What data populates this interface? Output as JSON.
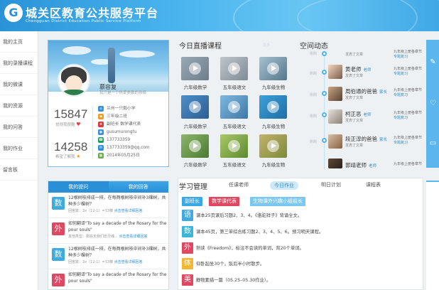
{
  "header": {
    "title": "城关区教育公共服务平台",
    "subtitle": "Chengguan District Education Public Service Platform"
  },
  "sidebar": {
    "items": [
      {
        "label": "我的主页"
      },
      {
        "label": "我的录播课程"
      },
      {
        "label": "我的微课"
      },
      {
        "label": "我的资源"
      },
      {
        "label": "我的问答"
      },
      {
        "label": "我的作业"
      },
      {
        "label": "留言板"
      }
    ]
  },
  "profile": {
    "name": "慕容复",
    "motto": "我只是一个热爱美数的孩纸",
    "stat1_value": "15847",
    "stat1_label": "觉得我很酷",
    "stat2_value": "14258",
    "stat2_label": "希望了解我",
    "info": [
      {
        "text": "兰州一只毅小学",
        "color": "#3b8fd4"
      },
      {
        "text": "三年级二班",
        "color": "#f59a23"
      },
      {
        "text": "副班长  数学课代表",
        "color": "#e3393c"
      },
      {
        "text": "gusumurongfu",
        "color": "#3b8fd4"
      },
      {
        "text": "137733359",
        "color": "#19a05a"
      },
      {
        "text": "137733359@qq.com",
        "color": "#2a8fd6"
      },
      {
        "text": "2014年05月25日",
        "color": "#6aa84f"
      }
    ]
  },
  "qa": {
    "tab_questions": "我的提问",
    "tab_answers": "我的回答",
    "items": [
      {
        "badge": "数",
        "color": "#3fa9e0",
        "text": "12根树枝排成一排，在每两根树枝中间补3棵树，共种多少棵树？",
        "meta": "回答数：3x（12-1）=33棵",
        "link": "点击查看详细回答"
      },
      {
        "badge": "外",
        "color": "#e04760",
        "text": "如何翻译\"To say a decade of the Rosary for the pour souls\"",
        "meta": "其他类型：那些天我们愿灵魂...",
        "link": "点击查看详细回答"
      },
      {
        "badge": "数",
        "color": "#3fa9e0",
        "text": "12根树枝排成一排，在每两根树枝中间补3棵树，共种多少棵树？",
        "meta": "回答数：3x（12-1）=33棵",
        "link": "点击查看详细回答"
      },
      {
        "badge": "外",
        "color": "#e04760",
        "text": "如何翻译\"To say a decade of the Rosary for the pour souls\"",
        "meta": "",
        "link": ""
      }
    ]
  },
  "live": {
    "title": "今日直播课程",
    "more": "更多",
    "courses": [
      {
        "label": "六年级数学"
      },
      {
        "label": "五年级语文"
      },
      {
        "label": "九年级生物"
      },
      {
        "label": "六年级数学"
      },
      {
        "label": "五年级语文"
      },
      {
        "label": "九年级生物"
      },
      {
        "label": "六年级数学"
      },
      {
        "label": "五年级语文"
      },
      {
        "label": "九年级生物"
      }
    ]
  },
  "space": {
    "title": "空间动态",
    "activities": [
      {
        "time": "刚刚",
        "name": "",
        "role": "",
        "desc": "发表了文章",
        "right1": "九年级上册各章节",
        "right2": "专题复习"
      },
      {
        "time": "刚刚",
        "name": "黄老师",
        "role": "老师",
        "desc": "发表了文章",
        "right1": "九年级上册各章节",
        "right2": "专题复习"
      },
      {
        "time": "刚刚",
        "name": "周伯通的爸爸",
        "role": "家长",
        "desc": "发表了文章",
        "right1": "九年级上册各章节",
        "right2": "专题复习"
      },
      {
        "time": "刚刚",
        "name": "柯正恶",
        "role": "老师",
        "desc": "发表了文章",
        "right1": "九年级上册各章节",
        "right2": "专题复习"
      },
      {
        "time": "刚刚",
        "name": "段正淳的爸爸",
        "role": "家长",
        "desc": "发表了文章",
        "right1": "九年级上册各章节",
        "right2": "专题复习"
      },
      {
        "time": "",
        "name": "郭靖老师",
        "role": "老师",
        "desc": "",
        "right1": "九年级上册各章节",
        "right2": ""
      }
    ]
  },
  "study": {
    "title": "学习管理",
    "tabs": [
      {
        "label": "任课老师"
      },
      {
        "label": "今日作业"
      },
      {
        "label": "明日计划"
      },
      {
        "label": "课程表"
      }
    ],
    "tags": [
      {
        "label": "副班长",
        "color": "#39a9e6"
      },
      {
        "label": "数学课代表",
        "color": "#e04760"
      },
      {
        "label": "生物课外兴趣小组组长",
        "color": "#7cc7ef"
      }
    ],
    "homework": [
      {
        "badge": "语",
        "color": "#3fa9e0",
        "text": "课本25页课后习题2、3、4。《骆驼祥子》背诵全文。"
      },
      {
        "badge": "数",
        "color": "#3bb6d6",
        "text": "课本45页，第三单综合练习题2、3、4、5、6。预习明天课程。"
      },
      {
        "badge": "外",
        "color": "#e04760",
        "text": "熟读《Freedom》，标注不会读的单词，背20个单词。"
      },
      {
        "badge": "体",
        "color": "#f5b731",
        "text": "仰卧起坐30个，饭后半小时散步。"
      },
      {
        "badge": "美",
        "color": "#e04760",
        "text": "静物素描一篇（05.25–05.30作业）。"
      }
    ]
  }
}
